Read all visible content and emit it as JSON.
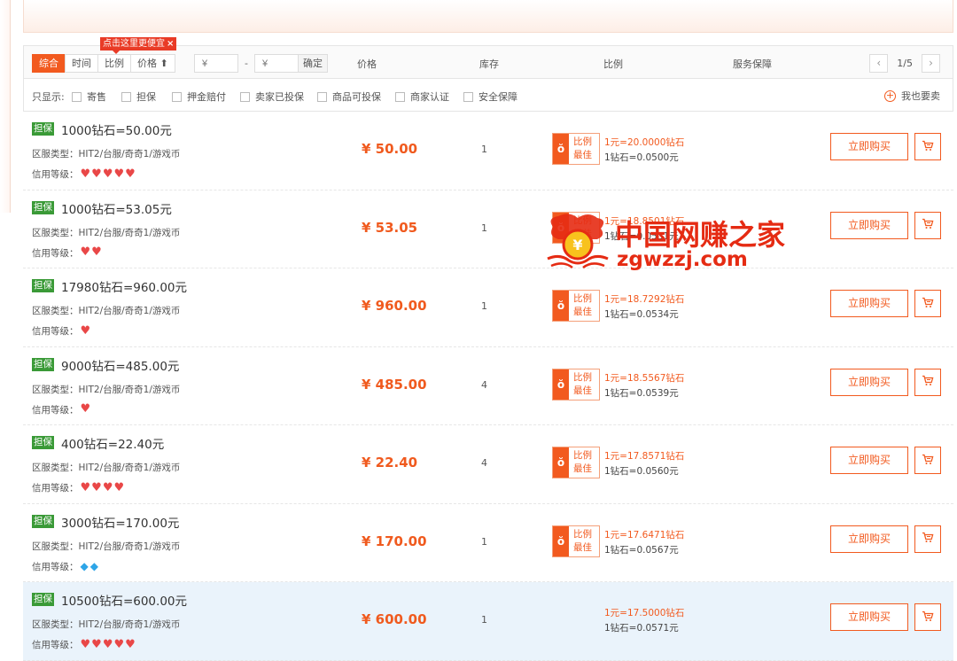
{
  "filter": {
    "sort_buttons": [
      "综合",
      "时间",
      "比例",
      "价格 ⬆"
    ],
    "tip_text": "点击这里更便宜",
    "tip_close": "×",
    "price_min_placeholder": "¥",
    "price_max_placeholder": "¥",
    "price_dash": "-",
    "ok_label": "确定",
    "col_price": "价格",
    "col_stock": "库存",
    "col_ratio": "比例",
    "col_service": "服务保障",
    "page": "1/5",
    "prev": "‹",
    "next": "›"
  },
  "only_show": {
    "label": "只显示:",
    "options": [
      "寄售",
      "担保",
      "押金赔付",
      "卖家已投保",
      "商品可投保",
      "商家认证",
      "安全保障"
    ],
    "sell_label": "我也要卖",
    "sell_icon": "+"
  },
  "listings": [
    {
      "tag": "担保",
      "title": "1000钻石=50.00元",
      "zone": "区服类型：HIT2/台服/奇奇1/游戏币",
      "credit_label": "信用等级：",
      "credit_icon": "heart",
      "credit_count": 5,
      "price": "¥ 50.00",
      "stock": "1",
      "badge": true,
      "ratio1": "1元=20.0000钻石",
      "ratio2": "1钻石=0.0500元",
      "buy": "立即购买"
    },
    {
      "tag": "担保",
      "title": "1000钻石=53.05元",
      "zone": "区服类型：HIT2/台服/奇奇1/游戏币",
      "credit_label": "信用等级：",
      "credit_icon": "heart",
      "credit_count": 2,
      "price": "¥ 53.05",
      "stock": "1",
      "badge": true,
      "ratio1": "1元=18.8501钻石",
      "ratio2": "1钻石=0.0531元",
      "buy": "立即购买"
    },
    {
      "tag": "担保",
      "title": "17980钻石=960.00元",
      "zone": "区服类型：HIT2/台服/奇奇1/游戏币",
      "credit_label": "信用等级：",
      "credit_icon": "heart",
      "credit_count": 1,
      "price": "¥ 960.00",
      "stock": "1",
      "badge": true,
      "ratio1": "1元=18.7292钻石",
      "ratio2": "1钻石=0.0534元",
      "buy": "立即购买"
    },
    {
      "tag": "担保",
      "title": "9000钻石=485.00元",
      "zone": "区服类型：HIT2/台服/奇奇1/游戏币",
      "credit_label": "信用等级：",
      "credit_icon": "heart",
      "credit_count": 1,
      "price": "¥ 485.00",
      "stock": "4",
      "badge": true,
      "ratio1": "1元=18.5567钻石",
      "ratio2": "1钻石=0.0539元",
      "buy": "立即购买"
    },
    {
      "tag": "担保",
      "title": "400钻石=22.40元",
      "zone": "区服类型：HIT2/台服/奇奇1/游戏币",
      "credit_label": "信用等级：",
      "credit_icon": "heart",
      "credit_count": 4,
      "price": "¥ 22.40",
      "stock": "4",
      "badge": true,
      "ratio1": "1元=17.8571钻石",
      "ratio2": "1钻石=0.0560元",
      "buy": "立即购买"
    },
    {
      "tag": "担保",
      "title": "3000钻石=170.00元",
      "zone": "区服类型：HIT2/台服/奇奇1/游戏币",
      "credit_label": "信用等级：",
      "credit_icon": "diamond",
      "credit_count": 2,
      "price": "¥ 170.00",
      "stock": "1",
      "badge": true,
      "ratio1": "1元=17.6471钻石",
      "ratio2": "1钻石=0.0567元",
      "buy": "立即购买"
    },
    {
      "tag": "担保",
      "title": "10500钻石=600.00元",
      "zone": "区服类型：HIT2/台服/奇奇1/游戏币",
      "credit_label": "信用等级：",
      "credit_icon": "heart",
      "credit_count": 5,
      "price": "¥ 600.00",
      "stock": "1",
      "badge": false,
      "ratio1": "1元=17.5000钻石",
      "ratio2": "1钻石=0.0571元",
      "buy": "立即购买"
    }
  ],
  "badge_text": [
    "比例",
    "最佳"
  ],
  "badge_icon": "ŏ",
  "watermark": {
    "line1": "中国网赚之家",
    "line2": "zgwzzj.com",
    "coin": "¥"
  },
  "colors": {
    "accent": "#f25a1f",
    "tag_green": "#3a9a37",
    "highlight_row": "#eaf3fb",
    "watermark_red": "#e52b13"
  }
}
